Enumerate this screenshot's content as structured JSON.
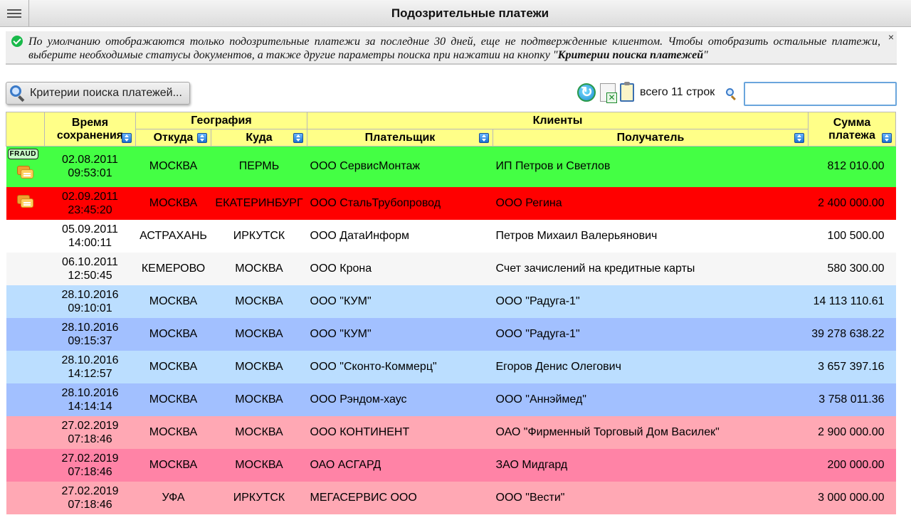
{
  "header": {
    "title": "Подозрительные платежи"
  },
  "notice": {
    "text": "По умолчанию отображаются только подозрительные платежи за последние 30 дней, еще не подтвержденные клиентом. Чтобы отобразить остальные платежи, выберите необходимые статусы документов, а также другие параметры поиска при нажатии на кнопку \"",
    "link": "Критерии поиска платежей",
    "text_end": "\"",
    "close_label": "×"
  },
  "toolbar": {
    "criteria_label": "Критерии поиска платежей...",
    "row_count": "всего 11 строк",
    "search_value": ""
  },
  "columns": {
    "time": "Время сохранения",
    "geo": "География",
    "from": "Откуда",
    "to": "Куда",
    "clients": "Клиенты",
    "payer": "Плательщик",
    "recipient": "Получатель",
    "amount": "Сумма платежа"
  },
  "row_colors": [
    "#44ff44",
    "#ff0000",
    "#ffffff",
    "#f6f6f6",
    "#bbdeff",
    "#a2c0ff",
    "#bbdeff",
    "#a2c0ff",
    "#ffa8b4",
    "#ff83a6",
    "#ffa8b4"
  ],
  "rows": [
    {
      "date": "02.08.2011",
      "time": "09:53:01",
      "from": "МОСКВА",
      "to": "ПЕРМЬ",
      "payer": "ООО СервисМонтаж",
      "recipient": "ИП Петров и Светлов",
      "amount": "812 010.00",
      "badge": "FRAUD",
      "chat": true
    },
    {
      "date": "02.09.2011",
      "time": "23:45:20",
      "from": "МОСКВА",
      "to": "ЕКАТЕРИНБУРГ",
      "payer": "ООО СтальТрубопровод",
      "recipient": "ООО Регина",
      "amount": "2 400 000.00",
      "badge": "",
      "chat": true
    },
    {
      "date": "05.09.2011",
      "time": "14:00:11",
      "from": "АСТРАХАНЬ",
      "to": "ИРКУТСК",
      "payer": "ООО ДатаИнформ",
      "recipient": "Петров Михаил Валерьянович",
      "amount": "100 500.00",
      "badge": "",
      "chat": false
    },
    {
      "date": "06.10.2011",
      "time": "12:50:45",
      "from": "КЕМЕРОВО",
      "to": "МОСКВА",
      "payer": "ООО Крона",
      "recipient": "Счет зачислений на кредитные карты",
      "amount": "580 300.00",
      "badge": "",
      "chat": false
    },
    {
      "date": "28.10.2016",
      "time": "09:10:01",
      "from": "МОСКВА",
      "to": "МОСКВА",
      "payer": "ООО \"КУМ\"",
      "recipient": "ООО \"Радуга-1\"",
      "amount": "14 113 110.61",
      "badge": "",
      "chat": false
    },
    {
      "date": "28.10.2016",
      "time": "09:15:37",
      "from": "МОСКВА",
      "to": "МОСКВА",
      "payer": "ООО \"КУМ\"",
      "recipient": "ООО \"Радуга-1\"",
      "amount": "39 278 638.22",
      "badge": "",
      "chat": false
    },
    {
      "date": "28.10.2016",
      "time": "14:12:57",
      "from": "МОСКВА",
      "to": "МОСКВА",
      "payer": "ООО \"Сконто-Коммерц\"",
      "recipient": "Егоров Денис Олегович",
      "amount": "3 657 397.16",
      "badge": "",
      "chat": false
    },
    {
      "date": "28.10.2016",
      "time": "14:14:14",
      "from": "МОСКВА",
      "to": "МОСКВА",
      "payer": "ООО Рэндом-хаус",
      "recipient": "ООО \"Аннэймед\"",
      "amount": "3 758 011.36",
      "badge": "",
      "chat": false
    },
    {
      "date": "27.02.2019",
      "time": "07:18:46",
      "from": "МОСКВА",
      "to": "МОСКВА",
      "payer": "ООО КОНТИНЕНТ",
      "recipient": "ОАО \"Фирменный Торговый Дом Василек\"",
      "amount": "2 900 000.00",
      "badge": "",
      "chat": false
    },
    {
      "date": "27.02.2019",
      "time": "07:18:46",
      "from": "МОСКВА",
      "to": "МОСКВА",
      "payer": "ОАО АСГАРД",
      "recipient": "ЗАО Мидгард",
      "amount": "200 000.00",
      "badge": "",
      "chat": false
    },
    {
      "date": "27.02.2019",
      "time": "07:18:46",
      "from": "УФА",
      "to": "ИРКУТСК",
      "payer": "МЕГАСЕРВИС ООО",
      "recipient": "ООО \"Вести\"",
      "amount": "3 000 000.00",
      "badge": "",
      "chat": false
    }
  ]
}
